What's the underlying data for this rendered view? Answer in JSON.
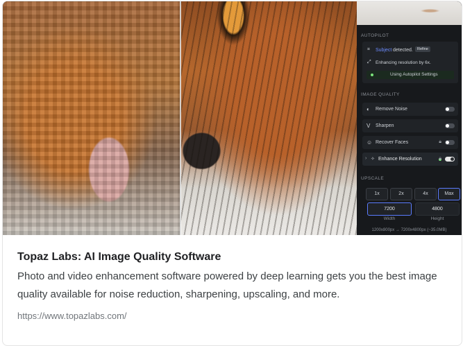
{
  "preview": {
    "panel": {
      "autopilot": {
        "heading": "AUTOPILOT",
        "subject_word": "Subject",
        "detected_word": "detected.",
        "refine_label": "Refine",
        "enhancing_text": "Enhancing resolution by 6x.",
        "using_text": "Using Autopilot Settings"
      },
      "image_quality": {
        "heading": "IMAGE QUALITY",
        "items": [
          {
            "label": "Remove Noise",
            "enabled": false
          },
          {
            "label": "Sharpen",
            "enabled": false
          },
          {
            "label": "Recover Faces",
            "enabled": false
          },
          {
            "label": "Enhance Resolution",
            "enabled": true
          }
        ]
      },
      "upscale": {
        "heading": "UPSCALE",
        "options": [
          "1x",
          "2x",
          "4x",
          "Max"
        ],
        "selected": "Max",
        "width_value": "7200",
        "height_value": "4800",
        "width_label": "Width",
        "height_label": "Height",
        "summary": "1200x800px → 7200x4800px (~35.0MB)"
      }
    }
  },
  "result": {
    "title": "Topaz Labs: AI Image Quality Software",
    "description": "Photo and video enhancement software powered by deep learning gets you the best image quality available for noise reduction, sharpening, upscaling, and more.",
    "url": "https://www.topazlabs.com/"
  },
  "colors": {
    "accent_blue": "#5b7cff",
    "status_green": "#7be37b",
    "panel_bg": "#17191c"
  }
}
